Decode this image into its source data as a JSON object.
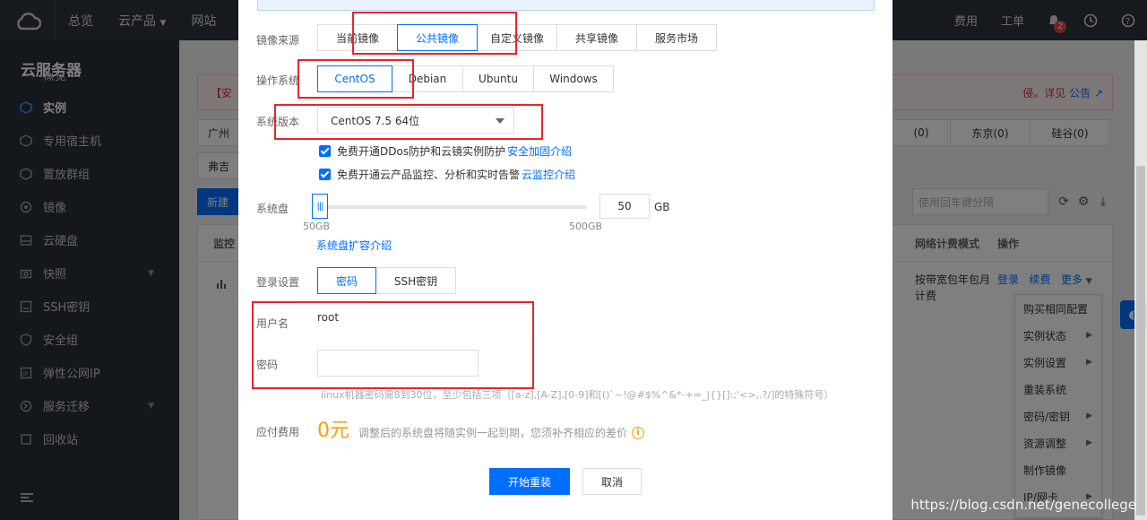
{
  "topbar": {
    "nav": [
      "总览",
      "云产品",
      "网站"
    ],
    "right": [
      "费用",
      "工单"
    ],
    "bell_badge": "2"
  },
  "sidebar": {
    "title": "云服务器",
    "items": [
      {
        "label": "概览"
      },
      {
        "label": "实例"
      },
      {
        "label": "专用宿主机"
      },
      {
        "label": "置放群组"
      },
      {
        "label": "镜像"
      },
      {
        "label": "云硬盘"
      },
      {
        "label": "快照"
      },
      {
        "label": "SSH密钥"
      },
      {
        "label": "安全组"
      },
      {
        "label": "弹性公网IP"
      },
      {
        "label": "服务迁移"
      },
      {
        "label": "回收站"
      }
    ]
  },
  "background": {
    "notice_left": "【安",
    "notice_right": "侵。详见",
    "notice_link": "公告",
    "regions_row1": [
      "广州",
      "(0)",
      "东京(0)",
      "硅谷(0)"
    ],
    "regions_row2": [
      "弗吉"
    ],
    "new_button": "新建",
    "search_placeholder": "使用回车键分隔",
    "table_headers": [
      "监控",
      "网络计费模式",
      "操作"
    ],
    "row_billing": "按带宽包年包月计费",
    "row_actions": [
      "登录",
      "续费",
      "更多"
    ],
    "dropdown": [
      "购买相同配置",
      "实例状态",
      "实例设置",
      "重装系统",
      "密码/密钥",
      "资源调整",
      "制作镜像",
      "IP/网卡"
    ]
  },
  "modal": {
    "image_source_label": "镜像来源",
    "image_source_options": [
      "当前镜像",
      "公共镜像",
      "自定义镜像",
      "共享镜像",
      "服务市场"
    ],
    "os_label": "操作系统",
    "os_options": [
      "CentOS",
      "Debian",
      "Ubuntu",
      "Windows"
    ],
    "version_label": "系统版本",
    "version_value": "CentOS 7.5 64位",
    "checkbox1_text": "免费开通DDos防护和云镜实例防护",
    "checkbox1_link": "安全加固介绍",
    "checkbox2_text": "免费开通云产品监控、分析和实时告警",
    "checkbox2_link": "云监控介绍",
    "disk_label": "系统盘",
    "disk_value": "50",
    "disk_unit": "GB",
    "disk_fill": 0.0,
    "disk_min": "50GB",
    "disk_max": "500GB",
    "disk_link": "系统盘扩容介绍",
    "login_label": "登录设置",
    "login_options": [
      "密码",
      "SSH密钥"
    ],
    "username_label": "用户名",
    "username_value": "root",
    "password_label": "密码",
    "password_hint": "linux机器密码需8到30位，至少包括三项（[a-z],[A-Z],[0-9]和[()`~!@#$%^&*-+=_|{}[]:;'<>,.?/]的特殊符号）",
    "fee_label": "应付费用",
    "fee_value": "0元",
    "fee_note": "调整后的系统盘将随实例一起到期，您须补齐相应的差价",
    "confirm_button": "开始重装",
    "cancel_button": "取消"
  },
  "watermark": "https://blog.csdn.net/genecollege",
  "colors": {
    "accent": "#006eff",
    "highlight": "#e8242c",
    "price": "#ff9d00"
  }
}
